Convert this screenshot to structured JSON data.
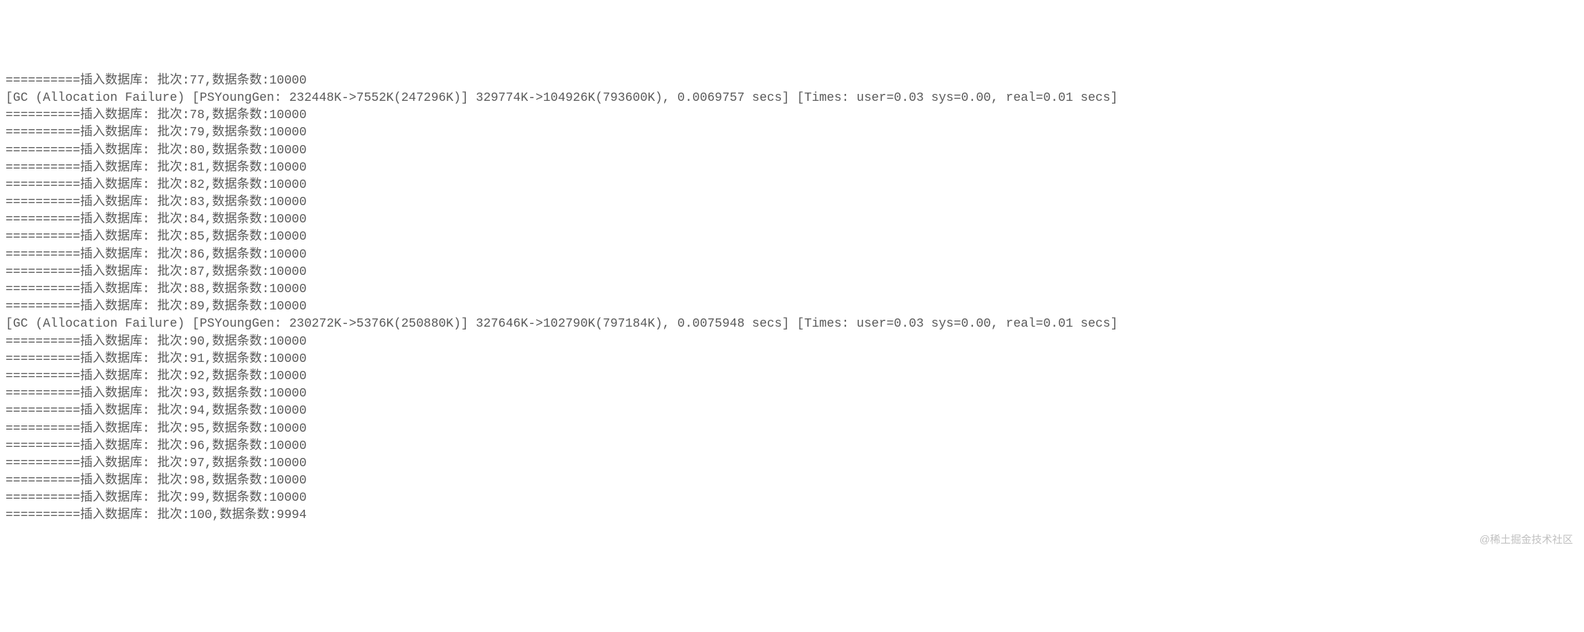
{
  "log": {
    "separator": "==========",
    "insert_prefix": "插入数据库: 批次:",
    "count_prefix": ",数据条数:",
    "lines": [
      {
        "type": "insert",
        "batch": "77",
        "count": "10000"
      },
      {
        "type": "gc",
        "text": "[GC (Allocation Failure) [PSYoungGen: 232448K->7552K(247296K)] 329774K->104926K(793600K), 0.0069757 secs] [Times: user=0.03 sys=0.00, real=0.01 secs]"
      },
      {
        "type": "insert",
        "batch": "78",
        "count": "10000"
      },
      {
        "type": "insert",
        "batch": "79",
        "count": "10000"
      },
      {
        "type": "insert",
        "batch": "80",
        "count": "10000"
      },
      {
        "type": "insert",
        "batch": "81",
        "count": "10000"
      },
      {
        "type": "insert",
        "batch": "82",
        "count": "10000"
      },
      {
        "type": "insert",
        "batch": "83",
        "count": "10000"
      },
      {
        "type": "insert",
        "batch": "84",
        "count": "10000"
      },
      {
        "type": "insert",
        "batch": "85",
        "count": "10000"
      },
      {
        "type": "insert",
        "batch": "86",
        "count": "10000"
      },
      {
        "type": "insert",
        "batch": "87",
        "count": "10000"
      },
      {
        "type": "insert",
        "batch": "88",
        "count": "10000"
      },
      {
        "type": "insert",
        "batch": "89",
        "count": "10000"
      },
      {
        "type": "gc",
        "text": "[GC (Allocation Failure) [PSYoungGen: 230272K->5376K(250880K)] 327646K->102790K(797184K), 0.0075948 secs] [Times: user=0.03 sys=0.00, real=0.01 secs]"
      },
      {
        "type": "insert",
        "batch": "90",
        "count": "10000"
      },
      {
        "type": "insert",
        "batch": "91",
        "count": "10000"
      },
      {
        "type": "insert",
        "batch": "92",
        "count": "10000"
      },
      {
        "type": "insert",
        "batch": "93",
        "count": "10000"
      },
      {
        "type": "insert",
        "batch": "94",
        "count": "10000"
      },
      {
        "type": "insert",
        "batch": "95",
        "count": "10000"
      },
      {
        "type": "insert",
        "batch": "96",
        "count": "10000"
      },
      {
        "type": "insert",
        "batch": "97",
        "count": "10000"
      },
      {
        "type": "insert",
        "batch": "98",
        "count": "10000"
      },
      {
        "type": "insert",
        "batch": "99",
        "count": "10000"
      },
      {
        "type": "insert",
        "batch": "100",
        "count": "9994"
      }
    ]
  },
  "watermark": "@稀土掘金技术社区"
}
